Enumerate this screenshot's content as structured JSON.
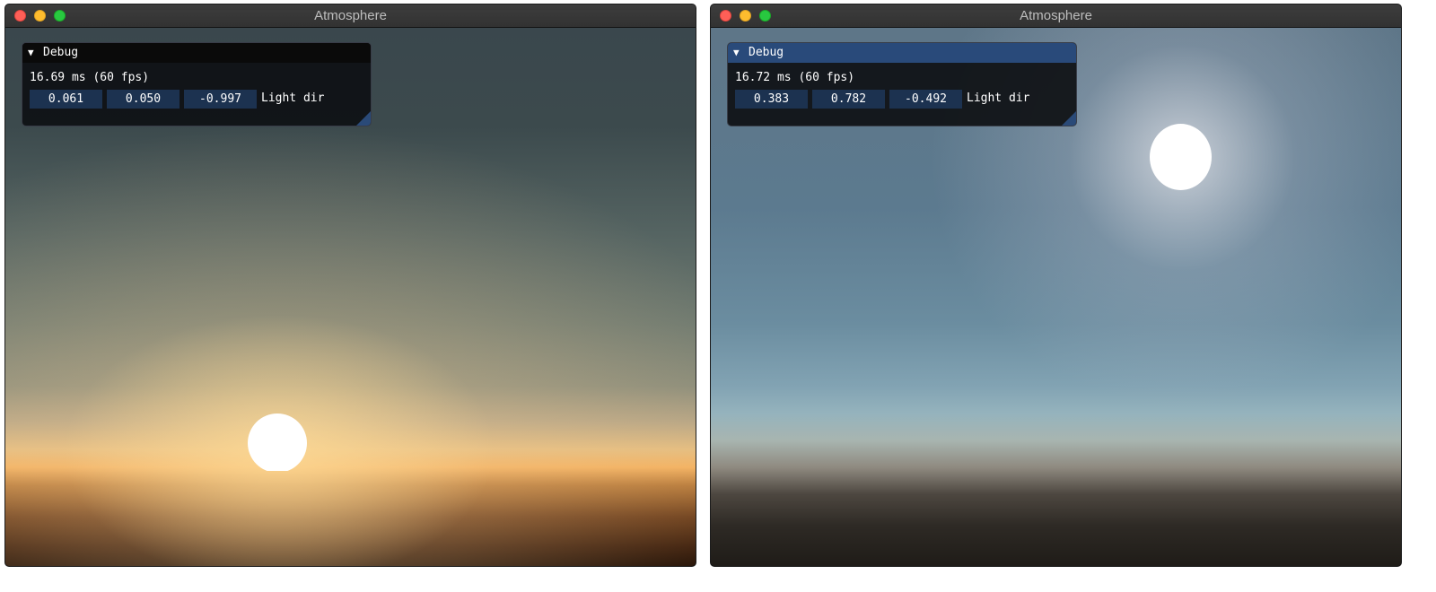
{
  "windows": [
    {
      "title": "Atmosphere",
      "debug": {
        "title": "Debug",
        "frame_time": "16.69 ms (60 fps)",
        "light_dir": [
          "0.061",
          "0.050",
          "-0.997"
        ],
        "light_dir_label": "Light dir"
      }
    },
    {
      "title": "Atmosphere",
      "debug": {
        "title": "Debug",
        "frame_time": "16.72 ms (60 fps)",
        "light_dir": [
          "0.383",
          "0.782",
          "-0.492"
        ],
        "light_dir_label": "Light dir"
      }
    }
  ],
  "icons": {
    "collapse": "▼"
  },
  "colors": {
    "close": "#fe5f57",
    "minimize": "#febc2e",
    "maximize": "#28c840",
    "field_bg": "#1c3250",
    "active_header": "#294a7a"
  }
}
